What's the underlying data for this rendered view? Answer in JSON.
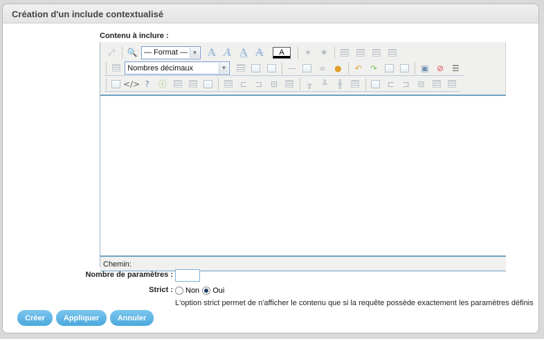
{
  "dialog": {
    "title": "Création d'un include contextualisé"
  },
  "form": {
    "contenu_label": "Contenu à inclure :",
    "format_select": "— Format —",
    "list_style_select": "Nombres décimaux",
    "color_button": "A",
    "path_label": "Chemin:",
    "params_label": "Nombre de paramètres :",
    "params_value": "",
    "strict_label": "Strict :",
    "strict_options": [
      "Non",
      "Oui"
    ],
    "strict_selected": "Oui",
    "strict_help": "L'option strict permet de n'afficher le contenu que si la requête possède exactement les paramètres définis"
  },
  "toolbar": {
    "icons_row1": [
      "fullscreen-icon",
      "search-icon",
      "bold-icon",
      "italic-icon",
      "underline-icon",
      "strikethrough-icon",
      "subscript-icon",
      "superscript-icon",
      "align-left-icon",
      "align-center-icon",
      "align-right-icon",
      "align-justify-icon"
    ],
    "icons_row2": [
      "numbered-list-icon",
      "bullet-list-icon",
      "outdent-icon",
      "indent-icon",
      "horizontal-rule-icon",
      "anchor-icon",
      "link-icon",
      "unlink-icon",
      "undo-icon",
      "redo-icon",
      "paste-word-icon",
      "paste-text-icon",
      "cleanup-icon",
      "spellcheck-icon",
      "visual-aid-icon"
    ],
    "icons_row3": [
      "code-icon",
      "html-icon",
      "help-icon",
      "info-icon",
      "table-icon",
      "table-props-icon",
      "cell-props-icon",
      "row-props-icon",
      "insert-row-before-icon",
      "insert-row-after-icon",
      "delete-row-icon",
      "split-cells-icon",
      "merge-cells-icon",
      "col-before-icon",
      "col-after-icon",
      "delete-col-icon",
      "table-grid-icon"
    ]
  },
  "buttons": {
    "create": "Créer",
    "apply": "Appliquer",
    "cancel": "Annuler"
  },
  "colors": {
    "button_blue": "#4aa8dc",
    "editor_border": "#6fa2c1"
  }
}
